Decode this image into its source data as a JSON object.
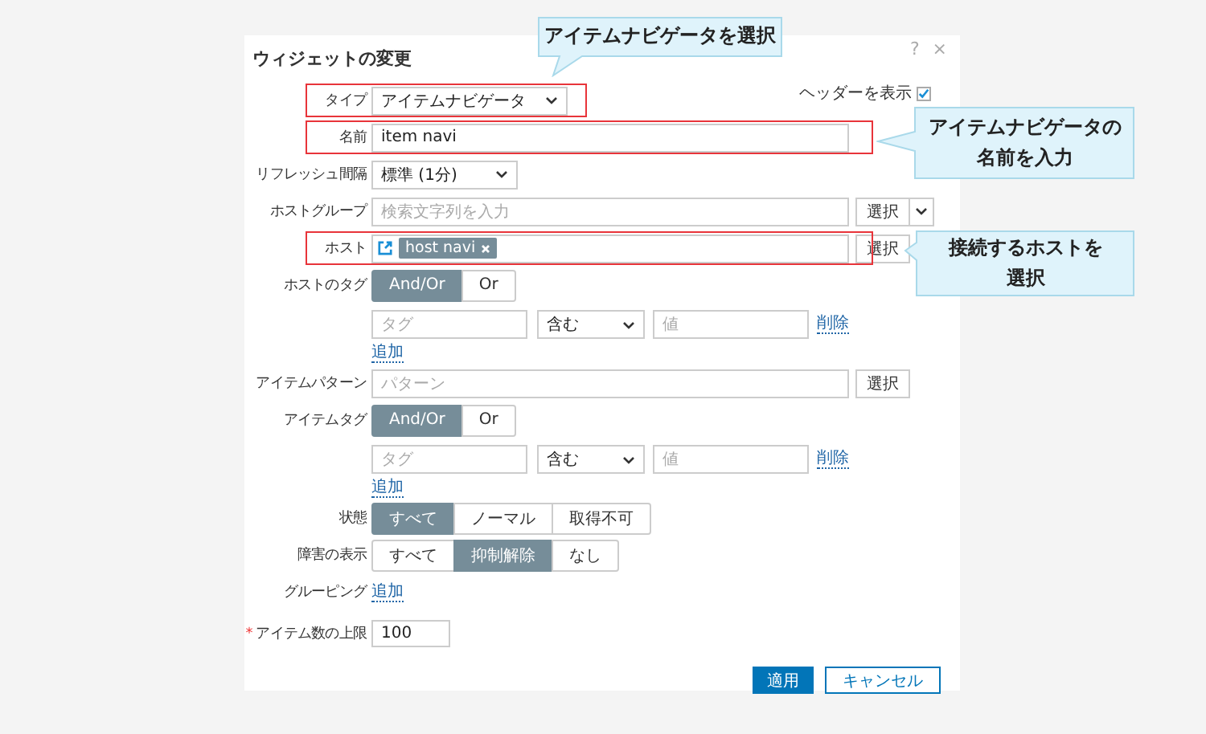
{
  "dialog": {
    "title": "ウィジェットの変更",
    "help": "?",
    "close": "×"
  },
  "header_toggle": {
    "label": "ヘッダーを表示",
    "checked": true
  },
  "fields": [
    {
      "kind": "select",
      "label": "タイプ",
      "value": "アイテムナビゲータ",
      "highlighted": true
    },
    {
      "kind": "text",
      "label": "名前",
      "value": "item navi",
      "highlighted": true
    },
    {
      "kind": "select",
      "label": "リフレッシュ間隔",
      "value": "標準 (1分)",
      "highlighted": false
    },
    {
      "kind": "multiselect",
      "label": "ホストグループ",
      "placeholder": "検索文字列を入力",
      "button": "選択",
      "highlighted": false
    },
    {
      "kind": "chips",
      "label": "ホスト",
      "chips": [
        "host navi"
      ],
      "button": "選択",
      "highlighted": true
    },
    {
      "kind": "segmented",
      "label": "ホストのタグ",
      "options": [
        {
          "label": "And/Or",
          "selected": true
        },
        {
          "label": "Or",
          "selected": false
        }
      ]
    },
    {
      "kind": "tags",
      "tag_placeholder": "タグ",
      "operator": "含む",
      "value_placeholder": "値",
      "remove": "削除",
      "add": "追加"
    },
    {
      "kind": "pattern",
      "label": "アイテムパターン",
      "placeholder": "パターン",
      "button": "選択"
    },
    {
      "kind": "segmented",
      "label": "アイテムタグ",
      "options": [
        {
          "label": "And/Or",
          "selected": true
        },
        {
          "label": "Or",
          "selected": false
        }
      ]
    },
    {
      "kind": "tags",
      "tag_placeholder": "タグ",
      "operator": "含む",
      "value_placeholder": "値",
      "remove": "削除",
      "add": "追加"
    },
    {
      "kind": "segmented",
      "label": "状態",
      "options": [
        {
          "label": "すべて",
          "selected": true
        },
        {
          "label": "ノーマル",
          "selected": false
        },
        {
          "label": "取得不可",
          "selected": false
        }
      ]
    },
    {
      "kind": "segmented",
      "label": "障害の表示",
      "options": [
        {
          "label": "すべて",
          "selected": false
        },
        {
          "label": "抑制解除",
          "selected": true
        },
        {
          "label": "なし",
          "selected": false
        }
      ]
    },
    {
      "kind": "link",
      "label": "グルーピング",
      "link": "追加"
    },
    {
      "kind": "number",
      "label": "アイテム数の上限",
      "value": "100",
      "required_mark": "*"
    }
  ],
  "buttons": [
    {
      "label": "適用",
      "primary": true
    },
    {
      "label": "キャンセル",
      "primary": false
    }
  ],
  "callouts": [
    {
      "text": "アイテムナビゲータを選択"
    },
    {
      "text": "アイテムナビゲータの名前を入力"
    },
    {
      "text": "接続するホストを選択"
    }
  ]
}
